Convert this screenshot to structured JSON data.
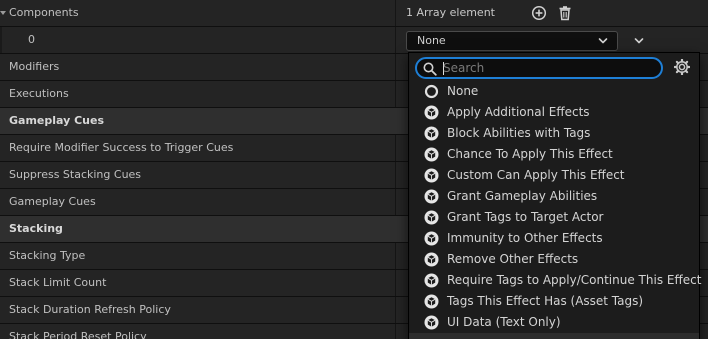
{
  "details": {
    "rows": [
      {
        "label": "Components",
        "kind": "array-header"
      },
      {
        "label": "0",
        "kind": "array-element"
      },
      {
        "label": "Modifiers",
        "kind": "property"
      },
      {
        "label": "Executions",
        "kind": "property"
      },
      {
        "label": "Gameplay Cues",
        "kind": "section"
      },
      {
        "label": "Require Modifier Success to Trigger Cues",
        "kind": "property"
      },
      {
        "label": "Suppress Stacking Cues",
        "kind": "property"
      },
      {
        "label": "Gameplay Cues",
        "kind": "property"
      },
      {
        "label": "Stacking",
        "kind": "section"
      },
      {
        "label": "Stacking Type",
        "kind": "property"
      },
      {
        "label": "Stack Limit Count",
        "kind": "property"
      },
      {
        "label": "Stack Duration Refresh Policy",
        "kind": "property"
      },
      {
        "label": "Stack Period Reset Policy",
        "kind": "property"
      }
    ],
    "components_value": "1 Array element",
    "element_value": "None"
  },
  "icons": {
    "add": "plus-circle-icon",
    "delete": "trash-icon",
    "combo": "chevron-down-icon",
    "search": "search-icon",
    "settings": "gear-icon",
    "none_option": "empty-circle-icon",
    "class_option": "class-cube-icon"
  },
  "popup": {
    "search_placeholder": "Search",
    "search_value": "",
    "options": [
      {
        "label": "None",
        "icon": "empty-circle-icon"
      },
      {
        "label": "Apply Additional Effects",
        "icon": "class-cube-icon"
      },
      {
        "label": "Block Abilities with Tags",
        "icon": "class-cube-icon"
      },
      {
        "label": "Chance To Apply This Effect",
        "icon": "class-cube-icon"
      },
      {
        "label": "Custom Can Apply This Effect",
        "icon": "class-cube-icon"
      },
      {
        "label": "Grant Gameplay Abilities",
        "icon": "class-cube-icon"
      },
      {
        "label": "Grant Tags to Target Actor",
        "icon": "class-cube-icon"
      },
      {
        "label": "Immunity to Other Effects",
        "icon": "class-cube-icon"
      },
      {
        "label": "Remove Other Effects",
        "icon": "class-cube-icon"
      },
      {
        "label": "Require Tags to Apply/Continue This Effect",
        "icon": "class-cube-icon"
      },
      {
        "label": "Tags This Effect Has (Asset Tags)",
        "icon": "class-cube-icon"
      },
      {
        "label": "UI Data (Text Only)",
        "icon": "class-cube-icon"
      }
    ]
  },
  "colors": {
    "panel_bg": "#242424",
    "section_bg": "#2f2f2f",
    "focus_accent": "#1e7fd6",
    "text": "#c0c0c0"
  }
}
